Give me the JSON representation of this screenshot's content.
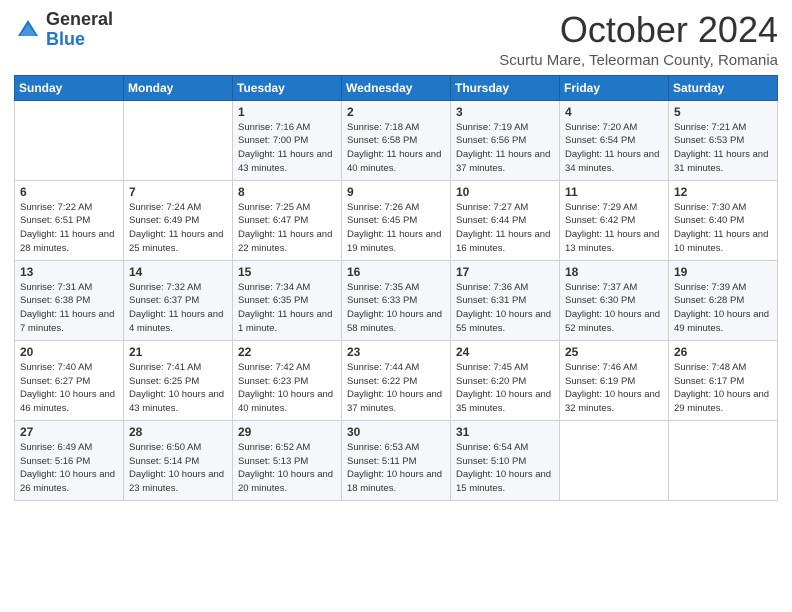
{
  "logo": {
    "general": "General",
    "blue": "Blue"
  },
  "header": {
    "month": "October 2024",
    "location": "Scurtu Mare, Teleorman County, Romania"
  },
  "days_of_week": [
    "Sunday",
    "Monday",
    "Tuesday",
    "Wednesday",
    "Thursday",
    "Friday",
    "Saturday"
  ],
  "weeks": [
    [
      {
        "day": "",
        "detail": ""
      },
      {
        "day": "",
        "detail": ""
      },
      {
        "day": "1",
        "detail": "Sunrise: 7:16 AM\nSunset: 7:00 PM\nDaylight: 11 hours and 43 minutes."
      },
      {
        "day": "2",
        "detail": "Sunrise: 7:18 AM\nSunset: 6:58 PM\nDaylight: 11 hours and 40 minutes."
      },
      {
        "day": "3",
        "detail": "Sunrise: 7:19 AM\nSunset: 6:56 PM\nDaylight: 11 hours and 37 minutes."
      },
      {
        "day": "4",
        "detail": "Sunrise: 7:20 AM\nSunset: 6:54 PM\nDaylight: 11 hours and 34 minutes."
      },
      {
        "day": "5",
        "detail": "Sunrise: 7:21 AM\nSunset: 6:53 PM\nDaylight: 11 hours and 31 minutes."
      }
    ],
    [
      {
        "day": "6",
        "detail": "Sunrise: 7:22 AM\nSunset: 6:51 PM\nDaylight: 11 hours and 28 minutes."
      },
      {
        "day": "7",
        "detail": "Sunrise: 7:24 AM\nSunset: 6:49 PM\nDaylight: 11 hours and 25 minutes."
      },
      {
        "day": "8",
        "detail": "Sunrise: 7:25 AM\nSunset: 6:47 PM\nDaylight: 11 hours and 22 minutes."
      },
      {
        "day": "9",
        "detail": "Sunrise: 7:26 AM\nSunset: 6:45 PM\nDaylight: 11 hours and 19 minutes."
      },
      {
        "day": "10",
        "detail": "Sunrise: 7:27 AM\nSunset: 6:44 PM\nDaylight: 11 hours and 16 minutes."
      },
      {
        "day": "11",
        "detail": "Sunrise: 7:29 AM\nSunset: 6:42 PM\nDaylight: 11 hours and 13 minutes."
      },
      {
        "day": "12",
        "detail": "Sunrise: 7:30 AM\nSunset: 6:40 PM\nDaylight: 11 hours and 10 minutes."
      }
    ],
    [
      {
        "day": "13",
        "detail": "Sunrise: 7:31 AM\nSunset: 6:38 PM\nDaylight: 11 hours and 7 minutes."
      },
      {
        "day": "14",
        "detail": "Sunrise: 7:32 AM\nSunset: 6:37 PM\nDaylight: 11 hours and 4 minutes."
      },
      {
        "day": "15",
        "detail": "Sunrise: 7:34 AM\nSunset: 6:35 PM\nDaylight: 11 hours and 1 minute."
      },
      {
        "day": "16",
        "detail": "Sunrise: 7:35 AM\nSunset: 6:33 PM\nDaylight: 10 hours and 58 minutes."
      },
      {
        "day": "17",
        "detail": "Sunrise: 7:36 AM\nSunset: 6:31 PM\nDaylight: 10 hours and 55 minutes."
      },
      {
        "day": "18",
        "detail": "Sunrise: 7:37 AM\nSunset: 6:30 PM\nDaylight: 10 hours and 52 minutes."
      },
      {
        "day": "19",
        "detail": "Sunrise: 7:39 AM\nSunset: 6:28 PM\nDaylight: 10 hours and 49 minutes."
      }
    ],
    [
      {
        "day": "20",
        "detail": "Sunrise: 7:40 AM\nSunset: 6:27 PM\nDaylight: 10 hours and 46 minutes."
      },
      {
        "day": "21",
        "detail": "Sunrise: 7:41 AM\nSunset: 6:25 PM\nDaylight: 10 hours and 43 minutes."
      },
      {
        "day": "22",
        "detail": "Sunrise: 7:42 AM\nSunset: 6:23 PM\nDaylight: 10 hours and 40 minutes."
      },
      {
        "day": "23",
        "detail": "Sunrise: 7:44 AM\nSunset: 6:22 PM\nDaylight: 10 hours and 37 minutes."
      },
      {
        "day": "24",
        "detail": "Sunrise: 7:45 AM\nSunset: 6:20 PM\nDaylight: 10 hours and 35 minutes."
      },
      {
        "day": "25",
        "detail": "Sunrise: 7:46 AM\nSunset: 6:19 PM\nDaylight: 10 hours and 32 minutes."
      },
      {
        "day": "26",
        "detail": "Sunrise: 7:48 AM\nSunset: 6:17 PM\nDaylight: 10 hours and 29 minutes."
      }
    ],
    [
      {
        "day": "27",
        "detail": "Sunrise: 6:49 AM\nSunset: 5:16 PM\nDaylight: 10 hours and 26 minutes."
      },
      {
        "day": "28",
        "detail": "Sunrise: 6:50 AM\nSunset: 5:14 PM\nDaylight: 10 hours and 23 minutes."
      },
      {
        "day": "29",
        "detail": "Sunrise: 6:52 AM\nSunset: 5:13 PM\nDaylight: 10 hours and 20 minutes."
      },
      {
        "day": "30",
        "detail": "Sunrise: 6:53 AM\nSunset: 5:11 PM\nDaylight: 10 hours and 18 minutes."
      },
      {
        "day": "31",
        "detail": "Sunrise: 6:54 AM\nSunset: 5:10 PM\nDaylight: 10 hours and 15 minutes."
      },
      {
        "day": "",
        "detail": ""
      },
      {
        "day": "",
        "detail": ""
      }
    ]
  ]
}
